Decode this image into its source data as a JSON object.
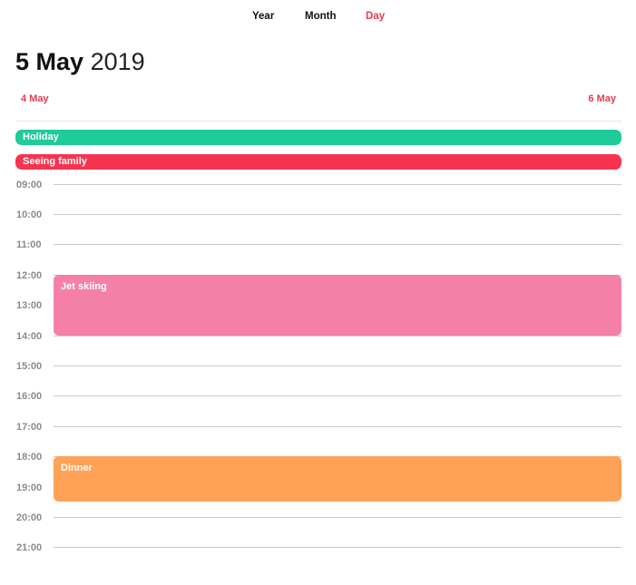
{
  "tabs": {
    "year": "Year",
    "month": "Month",
    "day": "Day",
    "active": "Day"
  },
  "header": {
    "day_month": "5 May",
    "year": "2019"
  },
  "nav": {
    "prev": "4 May",
    "next": "6 May"
  },
  "all_day_events": [
    {
      "title": "Holiday",
      "color": "#1fca9b"
    },
    {
      "title": "Seeing family",
      "color": "#f7344f"
    }
  ],
  "hours": [
    "09:00",
    "10:00",
    "11:00",
    "12:00",
    "13:00",
    "14:00",
    "15:00",
    "16:00",
    "17:00",
    "18:00",
    "19:00",
    "20:00",
    "21:00"
  ],
  "events": [
    {
      "title": "Jet skiing",
      "start": "12:00",
      "end": "14:00",
      "color": "#f480a8"
    },
    {
      "title": "Dinner",
      "start": "18:00",
      "end": "19:30",
      "color": "#ffa256"
    }
  ],
  "colors": {
    "accent": "#e53b4f",
    "grid_line": "#c9c9c9",
    "hour_label": "#8a8a8a"
  }
}
